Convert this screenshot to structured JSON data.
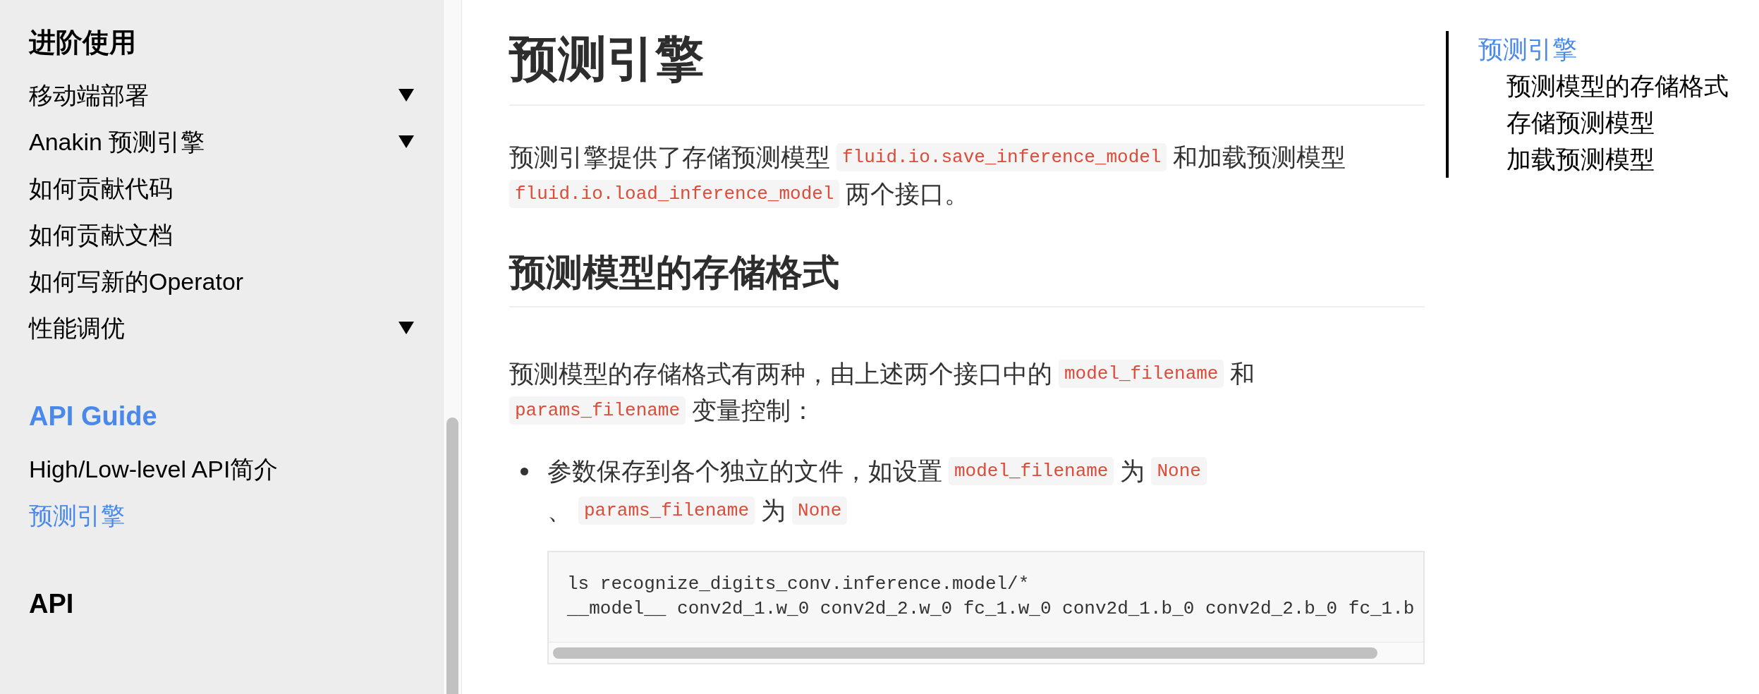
{
  "sidebar": {
    "sections": [
      {
        "title": "进阶使用",
        "selected": false,
        "items": [
          {
            "label": "移动端部署",
            "expandable": true,
            "selected": false
          },
          {
            "label": "Anakin 预测引擎",
            "expandable": true,
            "selected": false
          },
          {
            "label": "如何贡献代码",
            "expandable": false,
            "selected": false
          },
          {
            "label": "如何贡献文档",
            "expandable": false,
            "selected": false
          },
          {
            "label": "如何写新的Operator",
            "expandable": false,
            "selected": false
          },
          {
            "label": "性能调优",
            "expandable": true,
            "selected": false
          }
        ]
      },
      {
        "title": "API Guide",
        "selected": true,
        "items": [
          {
            "label": "High/Low-level API简介",
            "expandable": false,
            "selected": false
          },
          {
            "label": "预测引擎",
            "expandable": false,
            "selected": true
          }
        ]
      },
      {
        "title": "API",
        "selected": false
      }
    ]
  },
  "article": {
    "title": "预测引擎",
    "blocks": [
      {
        "kind": "paragraph",
        "lines": [
          [
            {
              "kind": "text",
              "text": "预测引擎提供了存储预测模型"
            },
            {
              "kind": "code",
              "text": "fluid.io.save_inference_model"
            },
            {
              "kind": "text",
              "text": "和加载预测模型"
            }
          ],
          [
            {
              "kind": "code",
              "text": "fluid.io.load_inference_model"
            },
            {
              "kind": "text",
              "text": "两个接口。"
            }
          ]
        ]
      },
      {
        "kind": "heading",
        "text": "预测模型的存储格式"
      },
      {
        "kind": "paragraph",
        "lines": [
          [
            {
              "kind": "text",
              "text": "预测模型的存储格式有两种，由上述两个接口中的"
            },
            {
              "kind": "code",
              "text": "model_filename"
            },
            {
              "kind": "text",
              "text": "和"
            }
          ],
          [
            {
              "kind": "code",
              "text": "params_filename"
            },
            {
              "kind": "text",
              "text": "变量控制："
            }
          ]
        ]
      },
      {
        "kind": "list",
        "items": [
          {
            "blocks": [
              {
                "kind": "paragraph",
                "lines": [
                  [
                    {
                      "kind": "text",
                      "text": "参数保存到各个独立的文件，如设置"
                    },
                    {
                      "kind": "code",
                      "text": "model_filename"
                    },
                    {
                      "kind": "text",
                      "text": "为"
                    },
                    {
                      "kind": "code",
                      "text": "None"
                    }
                  ],
                  [
                    {
                      "kind": "text",
                      "text": "、"
                    },
                    {
                      "kind": "code",
                      "text": "params_filename"
                    },
                    {
                      "kind": "text",
                      "text": "为"
                    },
                    {
                      "kind": "code",
                      "text": "None"
                    }
                  ]
                ]
              },
              {
                "kind": "code",
                "lines": [
                  "ls recognize_digits_conv.inference.model/*",
                  "__model__ conv2d_1.w_0 conv2d_2.w_0 fc_1.w_0 conv2d_1.b_0 conv2d_2.b_0 fc_1.b"
                ]
              }
            ]
          }
        ]
      }
    ]
  },
  "toc": {
    "items": [
      {
        "label": "预测引擎",
        "selected": true,
        "children": [
          {
            "label": "预测模型的存储格式",
            "selected": false
          },
          {
            "label": "存储预测模型",
            "selected": false
          },
          {
            "label": "加载预测模型",
            "selected": false
          }
        ]
      }
    ]
  }
}
